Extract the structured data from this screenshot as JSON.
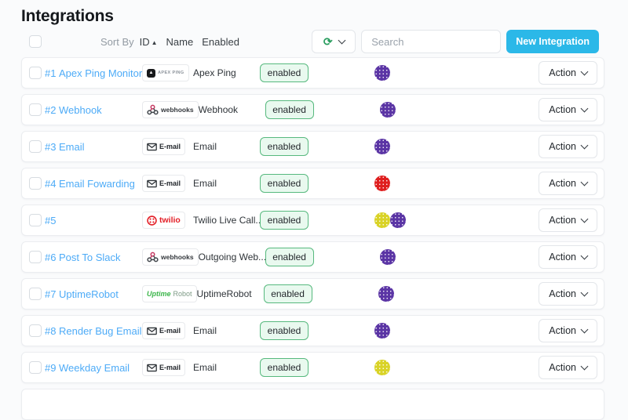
{
  "page": {
    "title": "Integrations"
  },
  "toolbar": {
    "sort_by": "Sort By",
    "sort_options": [
      {
        "label": "ID",
        "arrow": "▲",
        "active": true
      },
      {
        "label": "Name"
      },
      {
        "label": "Enabled"
      }
    ],
    "search_placeholder": "Search",
    "new_integration_label": "New Integration"
  },
  "labels": {
    "action": "Action"
  },
  "colors": {
    "accent": "#2bb8e8",
    "link": "#4dabf7",
    "enabled_bg": "#e9f9ef",
    "enabled_border": "#57b97e",
    "avatar_purple": "#5b35a5",
    "avatar_red": "#df1f1f",
    "avatar_yellow": "#d9d327"
  },
  "rows": [
    {
      "id_label": "#1",
      "name": "Apex Ping Monitor",
      "logo": {
        "kind": "apexping",
        "text": "APEX PING"
      },
      "type_label": "Apex Ping",
      "status": "enabled",
      "avatar_colors": [
        "#5b35a5"
      ]
    },
    {
      "id_label": "#2",
      "name": "Webhook",
      "logo": {
        "kind": "webhooks",
        "text": "webhooks"
      },
      "type_label": "Webhook",
      "status": "enabled",
      "avatar_colors": [
        "#5b35a5"
      ]
    },
    {
      "id_label": "#3",
      "name": "Email",
      "logo": {
        "kind": "email",
        "text": "E-mail"
      },
      "type_label": "Email",
      "status": "enabled",
      "avatar_colors": [
        "#5b35a5"
      ]
    },
    {
      "id_label": "#4",
      "name": "Email Fowarding",
      "logo": {
        "kind": "email",
        "text": "E-mail"
      },
      "type_label": "Email",
      "status": "enabled",
      "avatar_colors": [
        "#df1f1f"
      ]
    },
    {
      "id_label": "#5",
      "name": "",
      "logo": {
        "kind": "twilio",
        "text": "twilio"
      },
      "type_label": "Twilio Live Call...",
      "status": "enabled",
      "avatar_colors": [
        "#d9d327",
        "#5b35a5"
      ]
    },
    {
      "id_label": "#6",
      "name": "Post To Slack",
      "logo": {
        "kind": "webhooks",
        "text": "webhooks"
      },
      "type_label": "Outgoing Web...",
      "status": "enabled",
      "avatar_colors": [
        "#5b35a5"
      ]
    },
    {
      "id_label": "#7",
      "name": "UptimeRobot",
      "logo": {
        "kind": "uptimerobot",
        "text_parts": [
          "Uptime",
          "Robot"
        ]
      },
      "type_label": "UptimeRobot",
      "status": "enabled",
      "avatar_colors": [
        "#5b35a5"
      ]
    },
    {
      "id_label": "#8",
      "name": "Render Bug Email",
      "logo": {
        "kind": "email",
        "text": "E-mail"
      },
      "type_label": "Email",
      "status": "enabled",
      "avatar_colors": [
        "#5b35a5"
      ]
    },
    {
      "id_label": "#9",
      "name": "Weekday Email",
      "logo": {
        "kind": "email",
        "text": "E-mail"
      },
      "type_label": "Email",
      "status": "enabled",
      "avatar_colors": [
        "#d9d327"
      ]
    },
    {
      "partial": true
    }
  ]
}
